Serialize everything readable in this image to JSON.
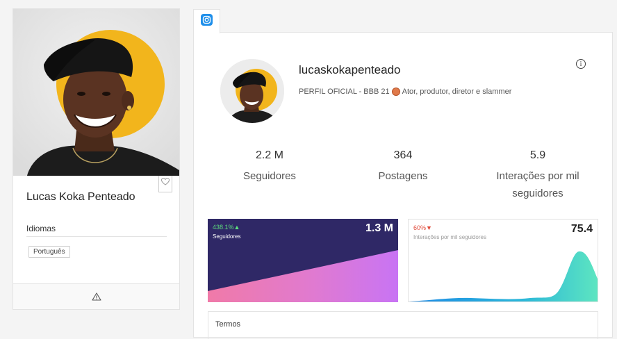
{
  "profile": {
    "name": "Lucas Koka Penteado",
    "languages_label": "Idiomas",
    "languages": [
      "Português"
    ]
  },
  "instagram": {
    "username": "lucaskokapenteado",
    "bio_prefix": "PERFIL OFICIAL - BBB 21",
    "bio_suffix": "Ator, produtor, diretor e slammer",
    "info_glyph": "i",
    "stats": [
      {
        "value": "2.2 M",
        "label": "Seguidores"
      },
      {
        "value": "364",
        "label": "Postagens"
      },
      {
        "value": "5.9",
        "label": "Interações por mil seguidores"
      }
    ],
    "followers_card": {
      "change": "438.1%",
      "change_direction": "up",
      "label": "Seguidores",
      "value": "1.3 M"
    },
    "interactions_card": {
      "change": "60%",
      "change_direction": "down",
      "label": "Interações por mil seguidores",
      "value": "75.4"
    },
    "terms_label": "Termos"
  },
  "icons": {
    "tab": "instagram-icon",
    "favorite": "heart-icon",
    "report": "warning-icon",
    "info": "info-icon",
    "bio_emoji": "basketball-icon"
  },
  "colors": {
    "instagram_blue": "#1f8fea",
    "followers_bg": "#2f2866",
    "positive": "#5ee07e",
    "negative": "#e04a3a",
    "sun_yellow": "#f2b51c"
  }
}
